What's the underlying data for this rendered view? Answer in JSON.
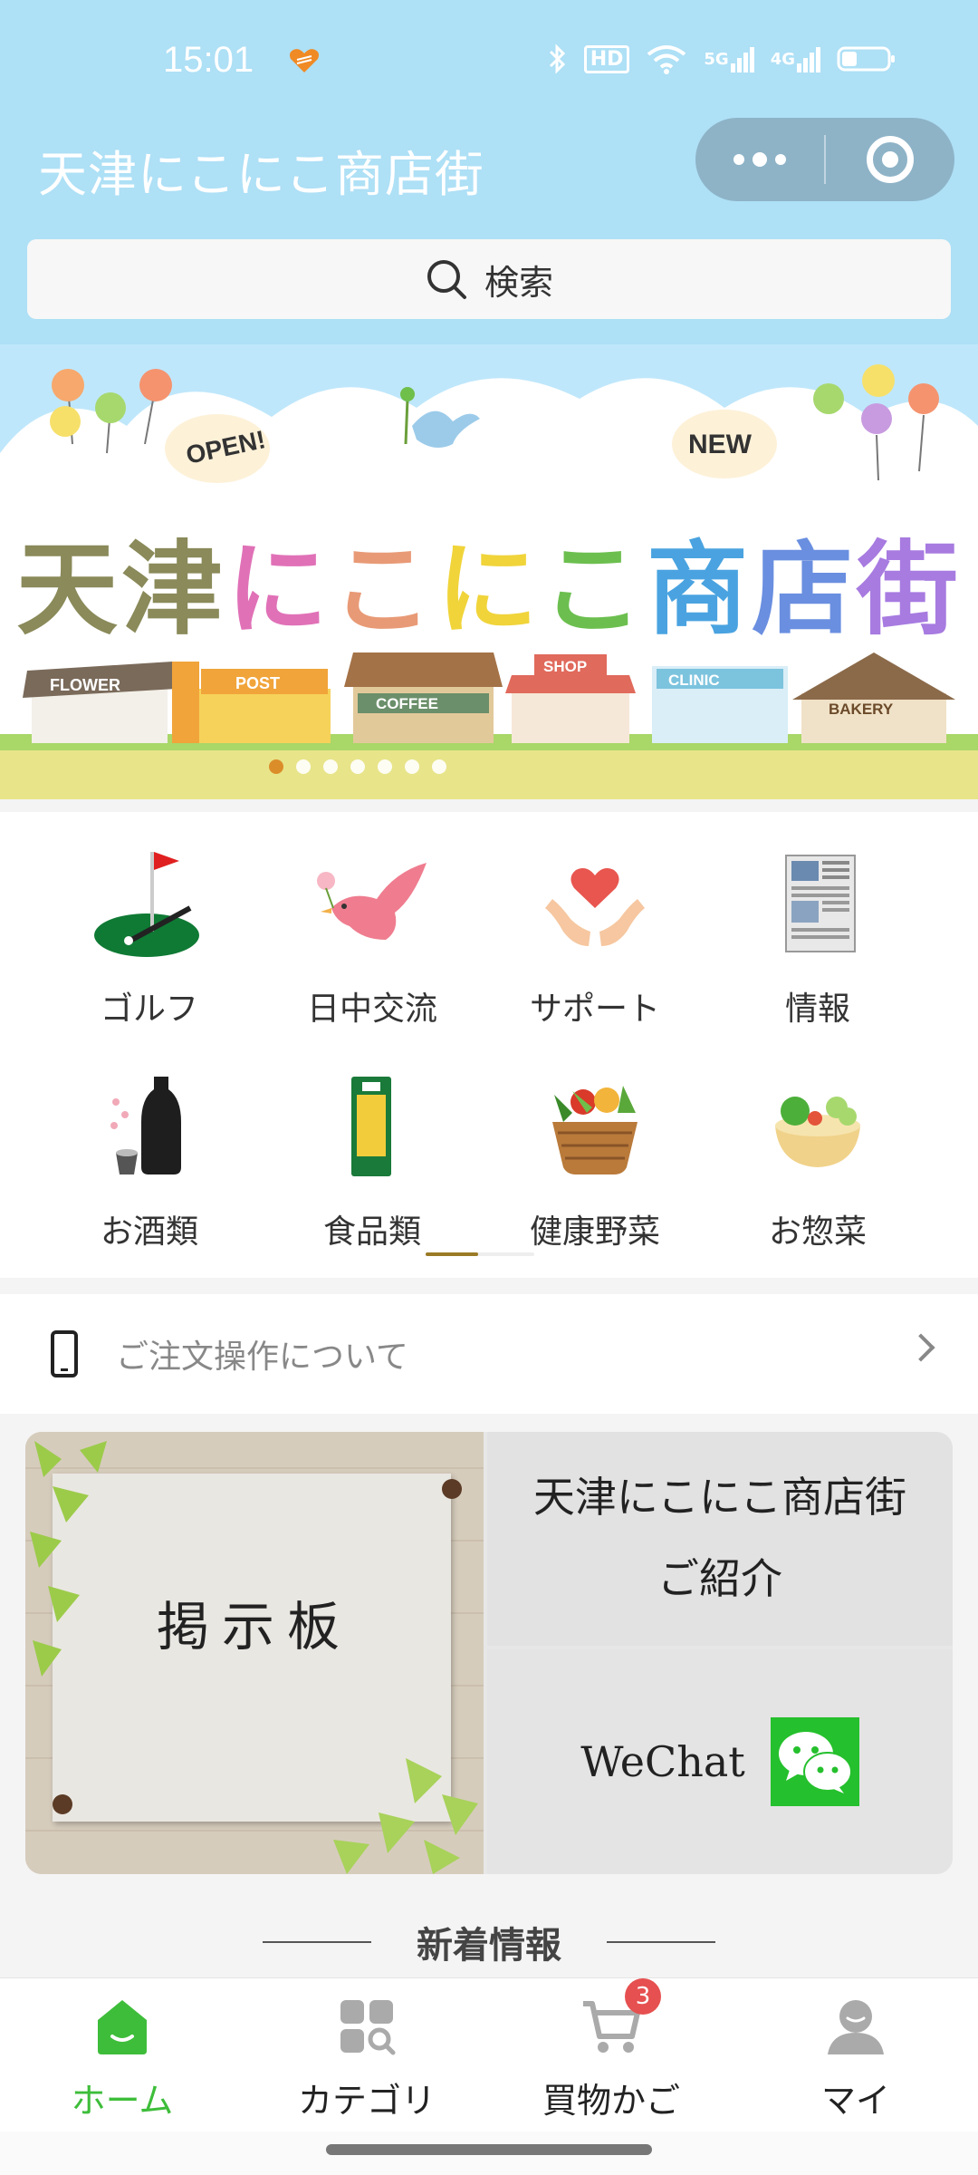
{
  "status_bar": {
    "time": "15:01",
    "network_labels": [
      "HD",
      "5G",
      "4G"
    ]
  },
  "header": {
    "title": "天津にこにこ商店街"
  },
  "search": {
    "placeholder": "検索",
    "label": "検索"
  },
  "banner": {
    "title_parts": [
      "天津",
      "に",
      "こ",
      "に",
      "こ",
      "商",
      "店",
      "街"
    ],
    "signs": [
      "OPEN!",
      "NEW",
      "FLOWER",
      "POST",
      "COFFEE",
      "SHOP",
      "CLINIC",
      "BAKERY"
    ],
    "slide_count": 7,
    "active_slide": 1
  },
  "categories": [
    {
      "label": "ゴルフ",
      "icon": "golf-icon"
    },
    {
      "label": "日中交流",
      "icon": "bird-icon"
    },
    {
      "label": "サポート",
      "icon": "heart-hands-icon"
    },
    {
      "label": "情報",
      "icon": "newspaper-icon"
    },
    {
      "label": "お酒類",
      "icon": "sake-icon"
    },
    {
      "label": "食品類",
      "icon": "food-pack-icon"
    },
    {
      "label": "健康野菜",
      "icon": "vegetable-basket-icon"
    },
    {
      "label": "お惣菜",
      "icon": "side-dish-icon"
    }
  ],
  "order_info": {
    "label": "ご注文操作について"
  },
  "board": {
    "title": "掲示板"
  },
  "intro": {
    "line1": "天津にこにこ商店街",
    "line2": "ご紹介"
  },
  "wechat": {
    "label": "WeChat"
  },
  "news": {
    "title": "新着情報"
  },
  "tabbar": {
    "tabs": [
      {
        "label": "ホーム",
        "icon": "home-icon",
        "active": true
      },
      {
        "label": "カテゴリ",
        "icon": "category-icon",
        "active": false
      },
      {
        "label": "買物かご",
        "icon": "cart-icon",
        "active": false,
        "badge": "3"
      },
      {
        "label": "マイ",
        "icon": "user-icon",
        "active": false
      }
    ]
  },
  "colors": {
    "header_bg": "#aee0f6",
    "active_tab": "#3ebd3a",
    "badge": "#e65050",
    "wechat_green": "#25c02d"
  }
}
